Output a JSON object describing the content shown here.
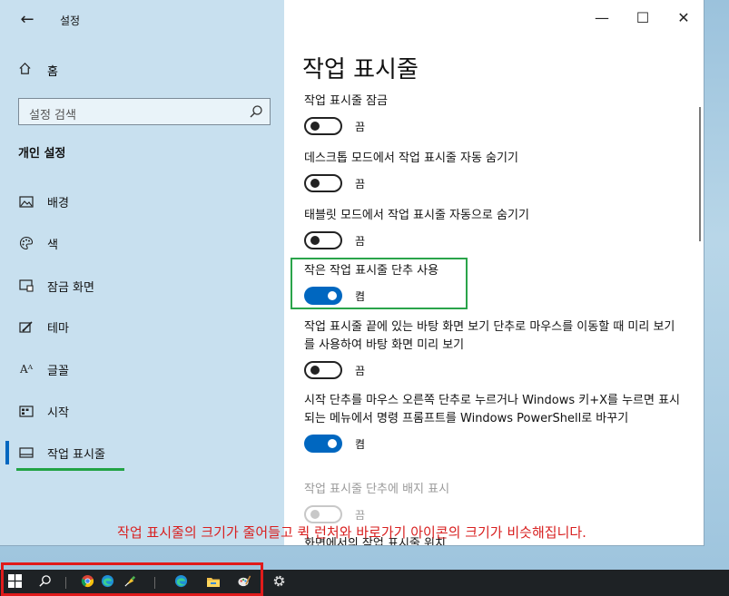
{
  "sidebar": {
    "title": "설정",
    "home_label": "홈",
    "search_placeholder": "설정 검색",
    "group_title": "개인 설정",
    "items": [
      {
        "label": "배경",
        "icon": "picture-icon"
      },
      {
        "label": "색",
        "icon": "palette-icon"
      },
      {
        "label": "잠금 화면",
        "icon": "lock-screen-icon"
      },
      {
        "label": "테마",
        "icon": "theme-brush-icon"
      },
      {
        "label": "글꼴",
        "icon": "font-icon"
      },
      {
        "label": "시작",
        "icon": "start-icon"
      },
      {
        "label": "작업 표시줄",
        "icon": "taskbar-icon",
        "selected": true
      }
    ]
  },
  "main": {
    "title": "작업 표시줄",
    "settings": [
      {
        "label": "작업 표시줄 잠금",
        "state": "끔",
        "on": false
      },
      {
        "label": "데스크톱 모드에서 작업 표시줄 자동 숨기기",
        "state": "끔",
        "on": false
      },
      {
        "label": "태블릿 모드에서 작업 표시줄 자동으로 숨기기",
        "state": "끔",
        "on": false
      },
      {
        "label": "작은 작업 표시줄 단추 사용",
        "state": "켬",
        "on": true
      },
      {
        "label": "작업 표시줄 끝에 있는 바탕 화면 보기 단추로 마우스를 이동할 때 미리 보기를 사용하여 바탕 화면 미리 보기",
        "state": "끔",
        "on": false
      },
      {
        "label": "시작 단추를 마우스 오른쪽 단추로 누르거나 Windows 키+X를 누르면 표시되는 메뉴에서 명령 프롬프트를 Windows PowerShell로 바꾸기",
        "state": "켬",
        "on": true
      },
      {
        "label": "작업 표시줄 단추에 배지 표시",
        "state": "끔",
        "on": false,
        "disabled": true
      }
    ],
    "partial_next_label": "화면에서의 작업 표시줄 위치"
  },
  "window_controls": {
    "minimize": "—",
    "maximize": "☐",
    "close": "✕"
  },
  "annotation_text": "작업 표시줄의 크기가 줄어들고 퀵 런처와 바로가기 아이콘의 크기가 비슷해집니다.",
  "colors": {
    "accent": "#0067c0",
    "highlight_green": "#2aa44a",
    "annotation_red": "#d81f1f"
  },
  "taskbar": {
    "items": [
      "windows-start-icon",
      "search-icon",
      "chrome-icon",
      "edge-icon",
      "pin-tool-icon",
      "edge-icon",
      "file-explorer-icon",
      "paint-icon",
      "settings-gear-icon"
    ]
  }
}
